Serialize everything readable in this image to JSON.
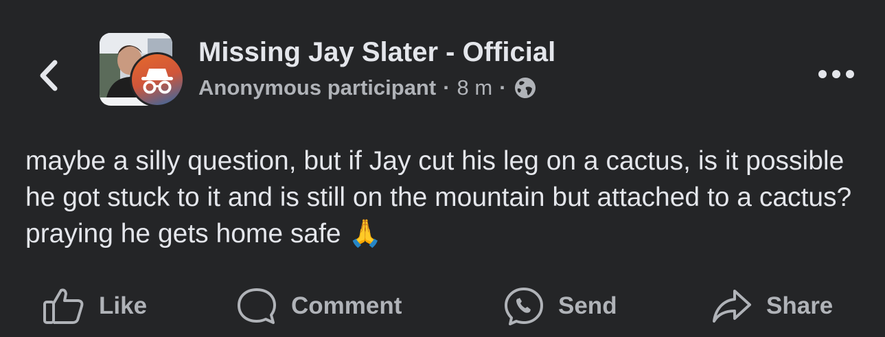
{
  "header": {
    "group_name": "Missing Jay Slater - Official",
    "author": "Anonymous participant",
    "separator": "·",
    "time": "8 m",
    "audience_icon": "globe-icon",
    "back_icon": "chevron-left-icon",
    "more_icon": "more-horizontal-icon",
    "badge_icon": "anonymous-incognito-icon"
  },
  "post": {
    "text": "maybe a silly question, but if Jay cut his leg on a cactus, is it possible he got stuck to it and is still on the mountain but attached to a cactus? praying he gets home safe",
    "emoji": "🙏"
  },
  "actions": [
    {
      "label": "Like",
      "icon": "thumbs-up-icon"
    },
    {
      "label": "Comment",
      "icon": "comment-icon"
    },
    {
      "label": "Send",
      "icon": "messenger-send-icon"
    },
    {
      "label": "Share",
      "icon": "share-icon"
    }
  ],
  "colors": {
    "background": "#242527",
    "primary_text": "#e4e6eb",
    "secondary_text": "#b0b3b8",
    "badge_orange": "#e56a2c",
    "badge_blue": "#2e6aa8"
  }
}
